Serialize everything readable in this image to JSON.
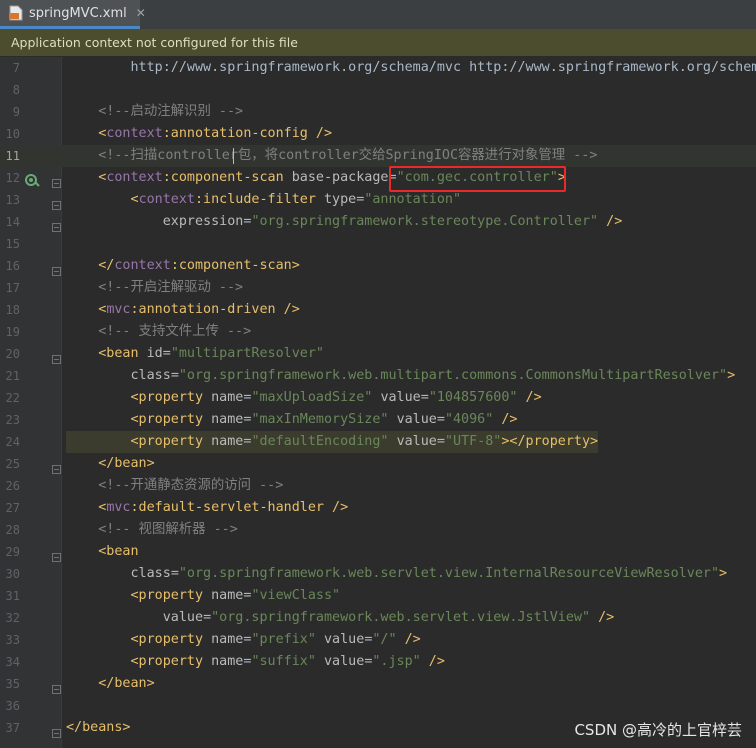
{
  "tab": {
    "filename": "springMVC.xml",
    "close_glyph": "✕"
  },
  "banner": {
    "text": "Application context not configured for this file"
  },
  "watermark": "CSDN @高冷的上官梓芸",
  "lines": [
    {
      "n": "7",
      "parts": [
        [
          "        ",
          "t-txt"
        ],
        [
          "http://www.springframework.org/schema/mvc http://www.springframework.org/schema/mvc/spring-mvc.xsd\">",
          "t-url"
        ]
      ]
    },
    {
      "n": "8",
      "parts": []
    },
    {
      "n": "9",
      "parts": [
        [
          "    ",
          "t-txt"
        ],
        [
          "<!--启动注解识别 -->",
          "t-cm"
        ]
      ]
    },
    {
      "n": "10",
      "parts": [
        [
          "    ",
          "t-txt"
        ],
        [
          "<",
          "t-tag"
        ],
        [
          "context",
          "t-ns"
        ],
        [
          ":annotation-config />",
          "t-tag"
        ]
      ]
    },
    {
      "n": "11",
      "parts": [
        [
          "    ",
          "t-txt"
        ],
        [
          "<!--扫描controller包，将controller交给SpringIOC容器进行对象管理 -->",
          "t-cm"
        ]
      ],
      "current": true
    },
    {
      "n": "12",
      "parts": [
        [
          "    ",
          "t-txt"
        ],
        [
          "<",
          "t-tag"
        ],
        [
          "context",
          "t-ns"
        ],
        [
          ":component-scan ",
          "t-tag"
        ],
        [
          "base-package",
          "t-attr"
        ],
        [
          "=",
          "t-txt"
        ],
        [
          "\"com.gec.controller\"",
          "t-val"
        ],
        [
          ">",
          "t-tag"
        ]
      ]
    },
    {
      "n": "13",
      "parts": [
        [
          "        ",
          "t-txt"
        ],
        [
          "<",
          "t-tag"
        ],
        [
          "context",
          "t-ns"
        ],
        [
          ":include-filter ",
          "t-tag"
        ],
        [
          "type",
          "t-attr"
        ],
        [
          "=",
          "t-txt"
        ],
        [
          "\"annotation\"",
          "t-val"
        ]
      ]
    },
    {
      "n": "14",
      "parts": [
        [
          "            ",
          "t-txt"
        ],
        [
          "expression",
          "t-attr"
        ],
        [
          "=",
          "t-txt"
        ],
        [
          "\"org.springframework.stereotype.Controller\"",
          "t-val"
        ],
        [
          " />",
          "t-tag"
        ]
      ]
    },
    {
      "n": "15",
      "parts": []
    },
    {
      "n": "16",
      "parts": [
        [
          "    ",
          "t-txt"
        ],
        [
          "</",
          "t-tag"
        ],
        [
          "context",
          "t-ns"
        ],
        [
          ":component-scan>",
          "t-tag"
        ]
      ]
    },
    {
      "n": "17",
      "parts": [
        [
          "    ",
          "t-txt"
        ],
        [
          "<!--开启注解驱动 -->",
          "t-cm"
        ]
      ]
    },
    {
      "n": "18",
      "parts": [
        [
          "    ",
          "t-txt"
        ],
        [
          "<",
          "t-tag"
        ],
        [
          "mvc",
          "t-ns"
        ],
        [
          ":annotation-driven />",
          "t-tag"
        ]
      ]
    },
    {
      "n": "19",
      "parts": [
        [
          "    ",
          "t-txt"
        ],
        [
          "<!-- 支持文件上传 -->",
          "t-cm"
        ]
      ]
    },
    {
      "n": "20",
      "parts": [
        [
          "    ",
          "t-txt"
        ],
        [
          "<bean ",
          "t-tag"
        ],
        [
          "id",
          "t-attr"
        ],
        [
          "=",
          "t-txt"
        ],
        [
          "\"multipartResolver\"",
          "t-val"
        ]
      ]
    },
    {
      "n": "21",
      "parts": [
        [
          "        ",
          "t-txt"
        ],
        [
          "class",
          "t-attr"
        ],
        [
          "=",
          "t-txt"
        ],
        [
          "\"org.springframework.web.multipart.commons.CommonsMultipartResolver\"",
          "t-val"
        ],
        [
          ">",
          "t-tag"
        ]
      ]
    },
    {
      "n": "22",
      "parts": [
        [
          "        ",
          "t-txt"
        ],
        [
          "<property ",
          "t-tag"
        ],
        [
          "name",
          "t-attr"
        ],
        [
          "=",
          "t-txt"
        ],
        [
          "\"maxUploadSize\"",
          "t-val"
        ],
        [
          " ",
          "t-txt"
        ],
        [
          "value",
          "t-attr"
        ],
        [
          "=",
          "t-txt"
        ],
        [
          "\"104857600\"",
          "t-val"
        ],
        [
          " />",
          "t-tag"
        ]
      ]
    },
    {
      "n": "23",
      "parts": [
        [
          "        ",
          "t-txt"
        ],
        [
          "<property ",
          "t-tag"
        ],
        [
          "name",
          "t-attr"
        ],
        [
          "=",
          "t-txt"
        ],
        [
          "\"maxInMemorySize\"",
          "t-val"
        ],
        [
          " ",
          "t-txt"
        ],
        [
          "value",
          "t-attr"
        ],
        [
          "=",
          "t-txt"
        ],
        [
          "\"4096\"",
          "t-val"
        ],
        [
          " />",
          "t-tag"
        ]
      ]
    },
    {
      "n": "24",
      "parts": [
        [
          "        ",
          "t-txt"
        ],
        [
          "<property ",
          "t-tag"
        ],
        [
          "name",
          "t-attr"
        ],
        [
          "=",
          "t-txt"
        ],
        [
          "\"defaultEncoding\"",
          "t-val"
        ],
        [
          " ",
          "t-txt"
        ],
        [
          "value",
          "t-attr"
        ],
        [
          "=",
          "t-txt"
        ],
        [
          "\"UTF-8\"",
          "t-val"
        ],
        [
          "></property>",
          "t-tag"
        ]
      ],
      "boxed": true
    },
    {
      "n": "25",
      "parts": [
        [
          "    ",
          "t-txt"
        ],
        [
          "</bean>",
          "t-tag"
        ]
      ]
    },
    {
      "n": "26",
      "parts": [
        [
          "    ",
          "t-txt"
        ],
        [
          "<!--开通静态资源的访问 -->",
          "t-cm"
        ]
      ]
    },
    {
      "n": "27",
      "parts": [
        [
          "    ",
          "t-txt"
        ],
        [
          "<",
          "t-tag"
        ],
        [
          "mvc",
          "t-ns"
        ],
        [
          ":default-servlet-handler />",
          "t-tag"
        ]
      ]
    },
    {
      "n": "28",
      "parts": [
        [
          "    ",
          "t-txt"
        ],
        [
          "<!-- 视图解析器 -->",
          "t-cm"
        ]
      ]
    },
    {
      "n": "29",
      "parts": [
        [
          "    ",
          "t-txt"
        ],
        [
          "<bean",
          "t-tag"
        ]
      ]
    },
    {
      "n": "30",
      "parts": [
        [
          "        ",
          "t-txt"
        ],
        [
          "class",
          "t-attr"
        ],
        [
          "=",
          "t-txt"
        ],
        [
          "\"org.springframework.web.servlet.view.InternalResourceViewResolver\"",
          "t-val"
        ],
        [
          ">",
          "t-tag"
        ]
      ]
    },
    {
      "n": "31",
      "parts": [
        [
          "        ",
          "t-txt"
        ],
        [
          "<property ",
          "t-tag"
        ],
        [
          "name",
          "t-attr"
        ],
        [
          "=",
          "t-txt"
        ],
        [
          "\"viewClass\"",
          "t-val"
        ]
      ]
    },
    {
      "n": "32",
      "parts": [
        [
          "            ",
          "t-txt"
        ],
        [
          "value",
          "t-attr"
        ],
        [
          "=",
          "t-txt"
        ],
        [
          "\"org.springframework.web.servlet.view.JstlView\"",
          "t-val"
        ],
        [
          " />",
          "t-tag"
        ]
      ]
    },
    {
      "n": "33",
      "parts": [
        [
          "        ",
          "t-txt"
        ],
        [
          "<property ",
          "t-tag"
        ],
        [
          "name",
          "t-attr"
        ],
        [
          "=",
          "t-txt"
        ],
        [
          "\"prefix\"",
          "t-val"
        ],
        [
          " ",
          "t-txt"
        ],
        [
          "value",
          "t-attr"
        ],
        [
          "=",
          "t-txt"
        ],
        [
          "\"/\"",
          "t-val"
        ],
        [
          " />",
          "t-tag"
        ]
      ]
    },
    {
      "n": "34",
      "parts": [
        [
          "        ",
          "t-txt"
        ],
        [
          "<property ",
          "t-tag"
        ],
        [
          "name",
          "t-attr"
        ],
        [
          "=",
          "t-txt"
        ],
        [
          "\"suffix\"",
          "t-val"
        ],
        [
          " ",
          "t-txt"
        ],
        [
          "value",
          "t-attr"
        ],
        [
          "=",
          "t-txt"
        ],
        [
          "\".jsp\"",
          "t-val"
        ],
        [
          " />",
          "t-tag"
        ]
      ]
    },
    {
      "n": "35",
      "parts": [
        [
          "    ",
          "t-txt"
        ],
        [
          "</bean>",
          "t-tag"
        ]
      ]
    },
    {
      "n": "36",
      "parts": []
    },
    {
      "n": "37",
      "parts": [
        [
          "</beans>",
          "t-tag"
        ]
      ]
    }
  ]
}
